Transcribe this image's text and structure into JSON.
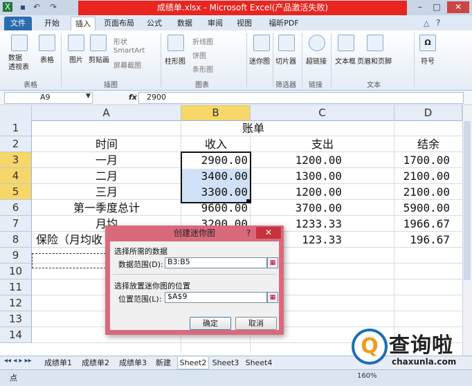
{
  "window": {
    "title": "成绩单.xlsx - Microsoft Excel(产品激活失败)",
    "title_color": "#e8251f",
    "controls": [
      "minimize-icon",
      "maximize-icon",
      "close-icon"
    ]
  },
  "quick_access": [
    "excel-logo-icon",
    "save-icon",
    "undo-icon",
    "redo-icon"
  ],
  "tabs": [
    "文件",
    "开始",
    "插入",
    "页面布局",
    "公式",
    "数据",
    "审阅",
    "视图",
    "福昕PDF"
  ],
  "active_tab": "插入",
  "ribbon": {
    "items": {
      "pivot_table": "数据\n透视表",
      "table": "表格",
      "picture": "图片",
      "clipart": "剪贴画",
      "shapes": "形状",
      "smartart": "SmartArt",
      "screenshot": "屏幕截图",
      "column": "柱形图",
      "line": "折线图",
      "pie": "饼图",
      "bar": "条形图",
      "sparkline": "迷你图",
      "slicer": "切片器",
      "hyperlink": "超链接",
      "textbox": "文本框",
      "header_footer": "页眉和页脚",
      "symbol": "符号"
    },
    "groups": {
      "tables": "表格",
      "illustrations": "插图",
      "charts": "图表",
      "filter": "筛选器",
      "links": "链接",
      "text": "文本"
    }
  },
  "formula_bar": {
    "name_box": "A9",
    "fx": "fx",
    "value": "2900"
  },
  "columns": [
    "A",
    "B",
    "C",
    "D"
  ],
  "rows": [
    "1",
    "2",
    "3",
    "4",
    "5",
    "6",
    "7",
    "8",
    "9",
    "10",
    "11",
    "12",
    "13",
    "14"
  ],
  "cells": {
    "title": "账单",
    "headers": [
      "时间",
      "收入",
      "支出",
      "结余"
    ],
    "r3": [
      "一月",
      "2900.00",
      "1200.00",
      "1700.00"
    ],
    "r4": [
      "二月",
      "3400.00",
      "1300.00",
      "2100.00"
    ],
    "r5": [
      "三月",
      "3300.00",
      "1200.00",
      "2100.00"
    ],
    "r6": [
      "第一季度总计",
      "9600.00",
      "3700.00",
      "5900.00"
    ],
    "r7": [
      "月均",
      "3200.00",
      "1233.33",
      "1966.67"
    ],
    "r8": [
      "保险（月均收",
      "",
      "123.33",
      "196.67"
    ]
  },
  "dialog": {
    "title": "创建迷你图",
    "help": "?",
    "close": "✕",
    "section1": "选择所需的数据",
    "data_range_label": "数据范围(D):",
    "data_range_value": "B3:B5",
    "section2": "选择放置迷你图的位置",
    "location_label": "位置范围(L):",
    "location_value": "$A$9",
    "ok": "确定",
    "cancel": "取消"
  },
  "sheets": [
    "成绩单1",
    "成绩单2",
    "成绩单3",
    "新建",
    "Sheet2",
    "Sheet3",
    "Sheet4"
  ],
  "active_sheet": "Sheet2",
  "status": {
    "mode": "点",
    "zoom": "160%"
  },
  "watermark": {
    "text": "查询啦",
    "url": "chaxunla.com"
  }
}
